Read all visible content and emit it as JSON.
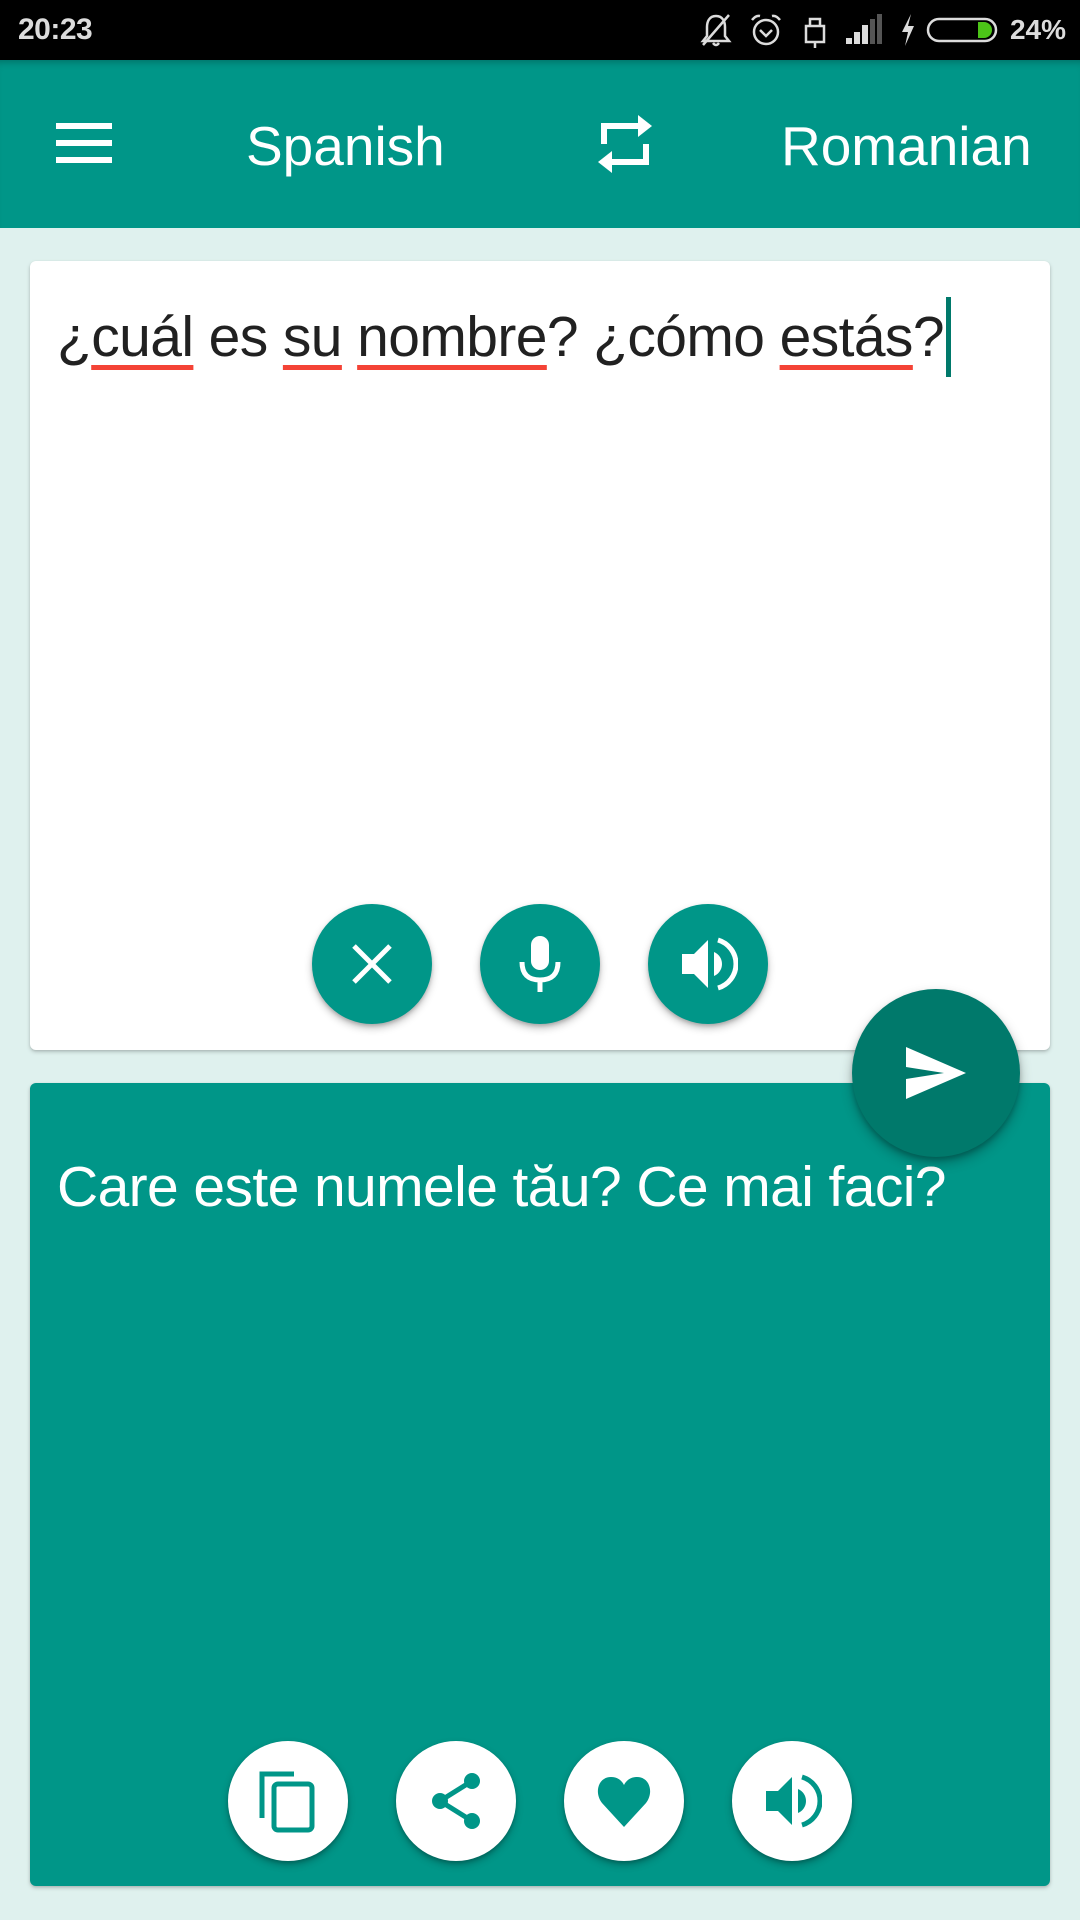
{
  "status_bar": {
    "time": "20:23",
    "battery_percent": "24%",
    "battery_level": 0.24,
    "icons": [
      "notifications-off-icon",
      "alarm-icon",
      "usb-lock-icon",
      "signal-icon",
      "charging-bolt-icon",
      "battery-icon"
    ]
  },
  "toolbar": {
    "menu_icon": "hamburger-menu-icon",
    "source_language": "Spanish",
    "swap_icon": "swap-languages-icon",
    "target_language": "Romanian"
  },
  "input_card": {
    "segments": [
      {
        "text": "¿",
        "misspelled": false
      },
      {
        "text": "cuál",
        "misspelled": true
      },
      {
        "text": " es ",
        "misspelled": false
      },
      {
        "text": "su",
        "misspelled": true
      },
      {
        "text": " ",
        "misspelled": false
      },
      {
        "text": "nombre",
        "misspelled": true
      },
      {
        "text": "? ¿cómo ",
        "misspelled": false
      },
      {
        "text": "estás",
        "misspelled": true
      },
      {
        "text": "?",
        "misspelled": false
      }
    ],
    "value": "¿cuál es su nombre? ¿cómo estás?",
    "buttons": [
      {
        "name": "clear",
        "icon": "close-icon"
      },
      {
        "name": "voice-input",
        "icon": "microphone-icon"
      },
      {
        "name": "speak-source",
        "icon": "volume-icon"
      }
    ]
  },
  "send_button": {
    "icon": "send-icon"
  },
  "output_card": {
    "text": "Care este numele tău? Ce mai faci?",
    "buttons": [
      {
        "name": "copy",
        "icon": "copy-icon"
      },
      {
        "name": "share",
        "icon": "share-icon"
      },
      {
        "name": "favorite",
        "icon": "heart-icon"
      },
      {
        "name": "speak-translation",
        "icon": "volume-icon"
      }
    ]
  },
  "colors": {
    "primary": "#009688",
    "primary_dark": "#00796b",
    "background": "#dff1ee",
    "spellcheck": "#f44336",
    "text": "#212121"
  }
}
